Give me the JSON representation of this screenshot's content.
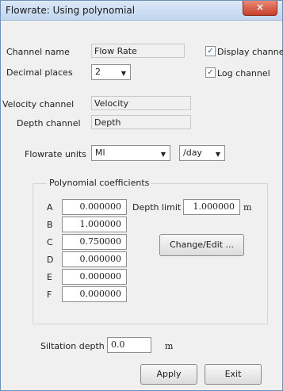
{
  "window": {
    "title": "Flowrate: Using polynomial",
    "close_icon": "×"
  },
  "channel": {
    "name_label": "Channel name",
    "name_value": "Flow Rate",
    "decimal_label": "Decimal places",
    "decimal_value": "2",
    "display_label": "Display channel",
    "display_checked": true,
    "log_label": "Log channel",
    "log_checked": true
  },
  "velocity": {
    "label": "Velocity channel",
    "value": "Velocity"
  },
  "depth": {
    "label": "Depth channel",
    "value": "Depth"
  },
  "units": {
    "label": "Flowrate units",
    "volume": "Ml",
    "per": "/day"
  },
  "coefficients": {
    "group_title": "Polynomial coefficients",
    "rows": [
      {
        "letter": "A",
        "value": "0.000000"
      },
      {
        "letter": "B",
        "value": "1.000000"
      },
      {
        "letter": "C",
        "value": "0.750000"
      },
      {
        "letter": "D",
        "value": "0.000000"
      },
      {
        "letter": "E",
        "value": "0.000000"
      },
      {
        "letter": "F",
        "value": "0.000000"
      }
    ],
    "depth_limit_label": "Depth limit",
    "depth_limit_value": "1.000000",
    "depth_limit_unit": "m",
    "change_edit_label": "Change/Edit ..."
  },
  "siltation": {
    "label": "Siltation depth",
    "value": "0.0",
    "unit": "m"
  },
  "buttons": {
    "apply": "Apply",
    "exit": "Exit"
  }
}
